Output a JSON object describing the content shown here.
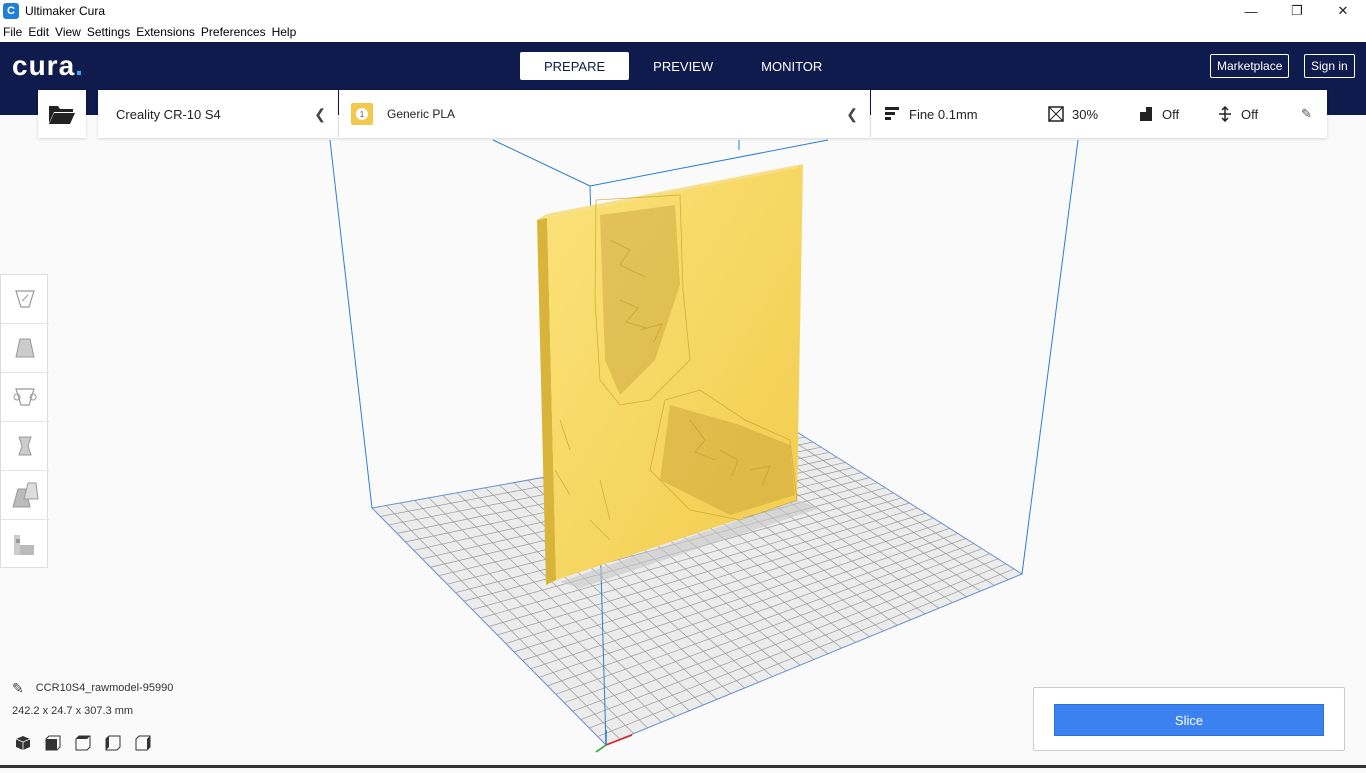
{
  "window": {
    "title": "Ultimaker Cura",
    "app_icon": "C",
    "controls": [
      "—",
      "❐",
      "✕"
    ]
  },
  "menu": {
    "items": [
      "File",
      "Edit",
      "View",
      "Settings",
      "Extensions",
      "Preferences",
      "Help"
    ]
  },
  "header": {
    "logo": "cura",
    "logo_dot": ".",
    "tabs": [
      "PREPARE",
      "PREVIEW",
      "MONITOR"
    ],
    "active_tab": "PREPARE",
    "marketplace": "Marketplace",
    "signin": "Sign in"
  },
  "machine": {
    "name": "Creality CR-10 S4"
  },
  "material": {
    "extruder": "1",
    "name": "Generic PLA"
  },
  "profile": {
    "quality": "Fine 0.1mm",
    "infill": "30%",
    "support": "Off",
    "adhesion": "Off"
  },
  "object": {
    "name": "CCR10S4_rawmodel-95990",
    "dimensions": "242.2 x 24.7 x 307.3 mm"
  },
  "slice": {
    "label": "Slice"
  },
  "colors": {
    "header_bg": "#0f1a4d",
    "accent": "#3b82f0",
    "model": "#f5d35a",
    "build_volume": "#1e7fd4"
  }
}
